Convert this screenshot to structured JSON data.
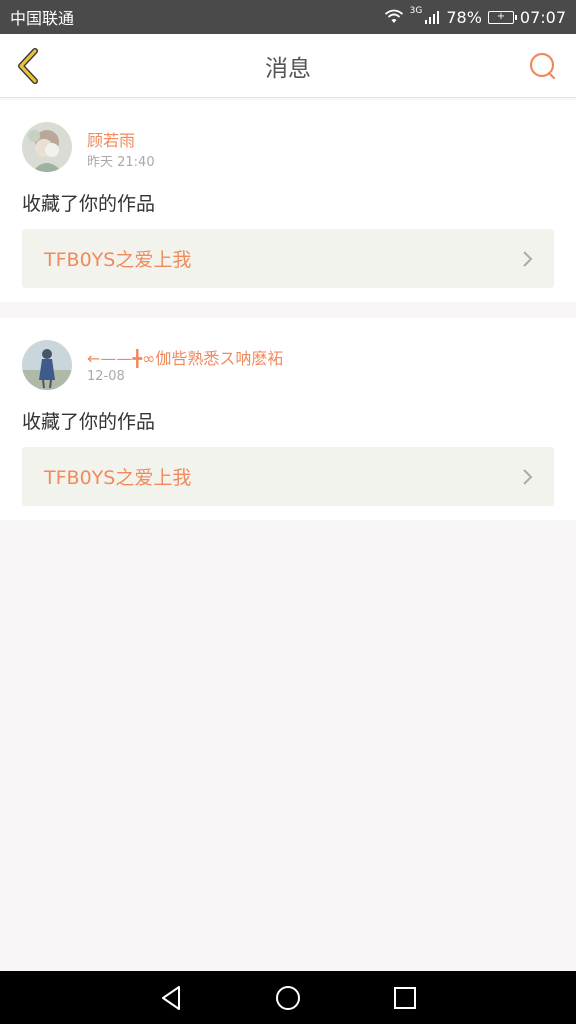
{
  "status_bar": {
    "carrier": "中国联通",
    "network_badge": "3G",
    "battery_percent": "78%",
    "time": "07:07"
  },
  "header": {
    "title": "消息"
  },
  "messages": [
    {
      "sender": "顾若雨",
      "time": "昨天 21:40",
      "action": "收藏了你的作品",
      "work_title": "TFB0YS之爱上我"
    },
    {
      "sender": "←——╋∞伽呰熟悉ス呐麽袥",
      "time": "12-08",
      "action": "收藏了你的作品",
      "work_title": "TFB0YS之爱上我"
    }
  ],
  "colors": {
    "accent": "#f08a5d",
    "back_arrow": "#e9c23a",
    "link_background": "#f3f3ed"
  },
  "icons": {
    "back": "chevron-left-icon",
    "search": "search-icon",
    "chevron": "chevron-right-icon",
    "nav_back": "triangle-back-icon",
    "nav_home": "circle-home-icon",
    "nav_recent": "square-recent-icon"
  }
}
